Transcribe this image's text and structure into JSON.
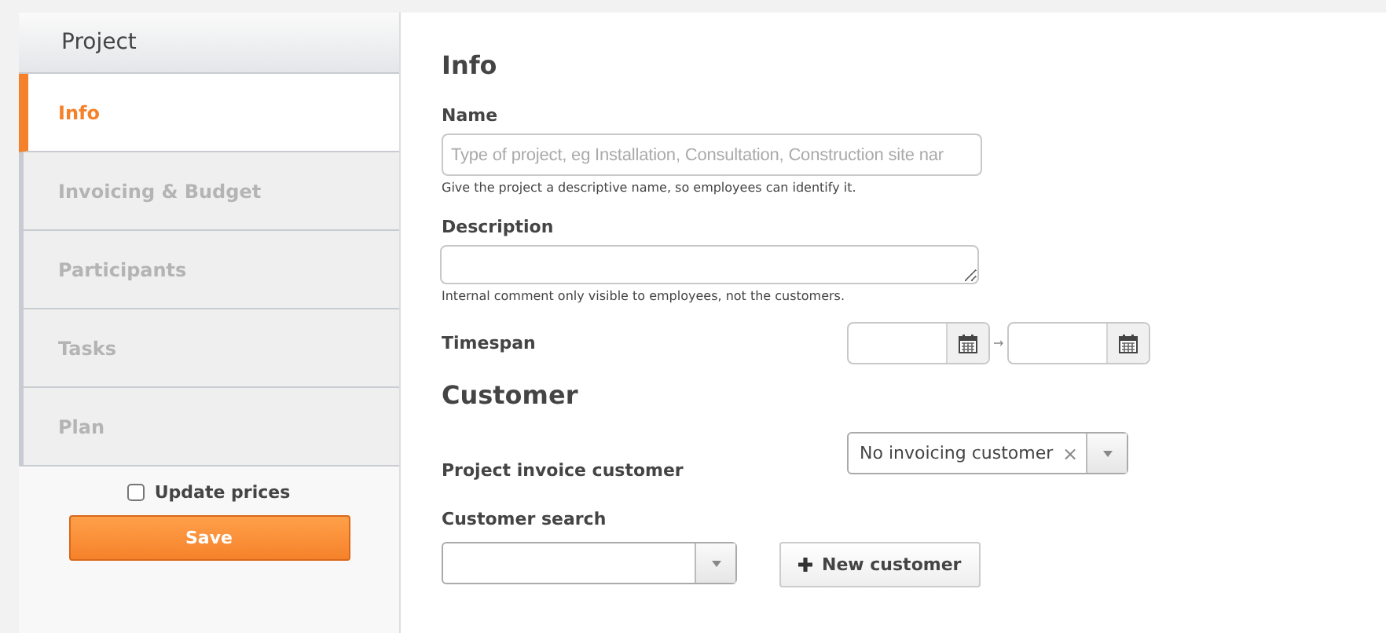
{
  "sidebar": {
    "title": "Project",
    "items": [
      {
        "label": "Info",
        "selected": true
      },
      {
        "label": "Invoicing & Budget",
        "selected": false
      },
      {
        "label": "Participants",
        "selected": false
      },
      {
        "label": "Tasks",
        "selected": false
      },
      {
        "label": "Plan",
        "selected": false
      }
    ],
    "update_prices": {
      "label": "Update prices",
      "checked": false
    },
    "save_button": "Save"
  },
  "info": {
    "heading": "Info",
    "name": {
      "label": "Name",
      "placeholder": "Type of project, eg Installation, Consultation, Construction site nar",
      "help": "Give the project a descriptive name, so employees can identify it."
    },
    "description": {
      "label": "Description",
      "help": "Internal comment only visible to employees, not the customers."
    },
    "timespan": {
      "label": "Timespan",
      "separator": "→"
    }
  },
  "customer": {
    "heading": "Customer",
    "invoice_customer": {
      "label": "Project invoice customer",
      "value": "No invoicing customer",
      "clear": "×"
    },
    "customer_search": {
      "label": "Customer search"
    },
    "new_customer_button": "New customer"
  }
}
